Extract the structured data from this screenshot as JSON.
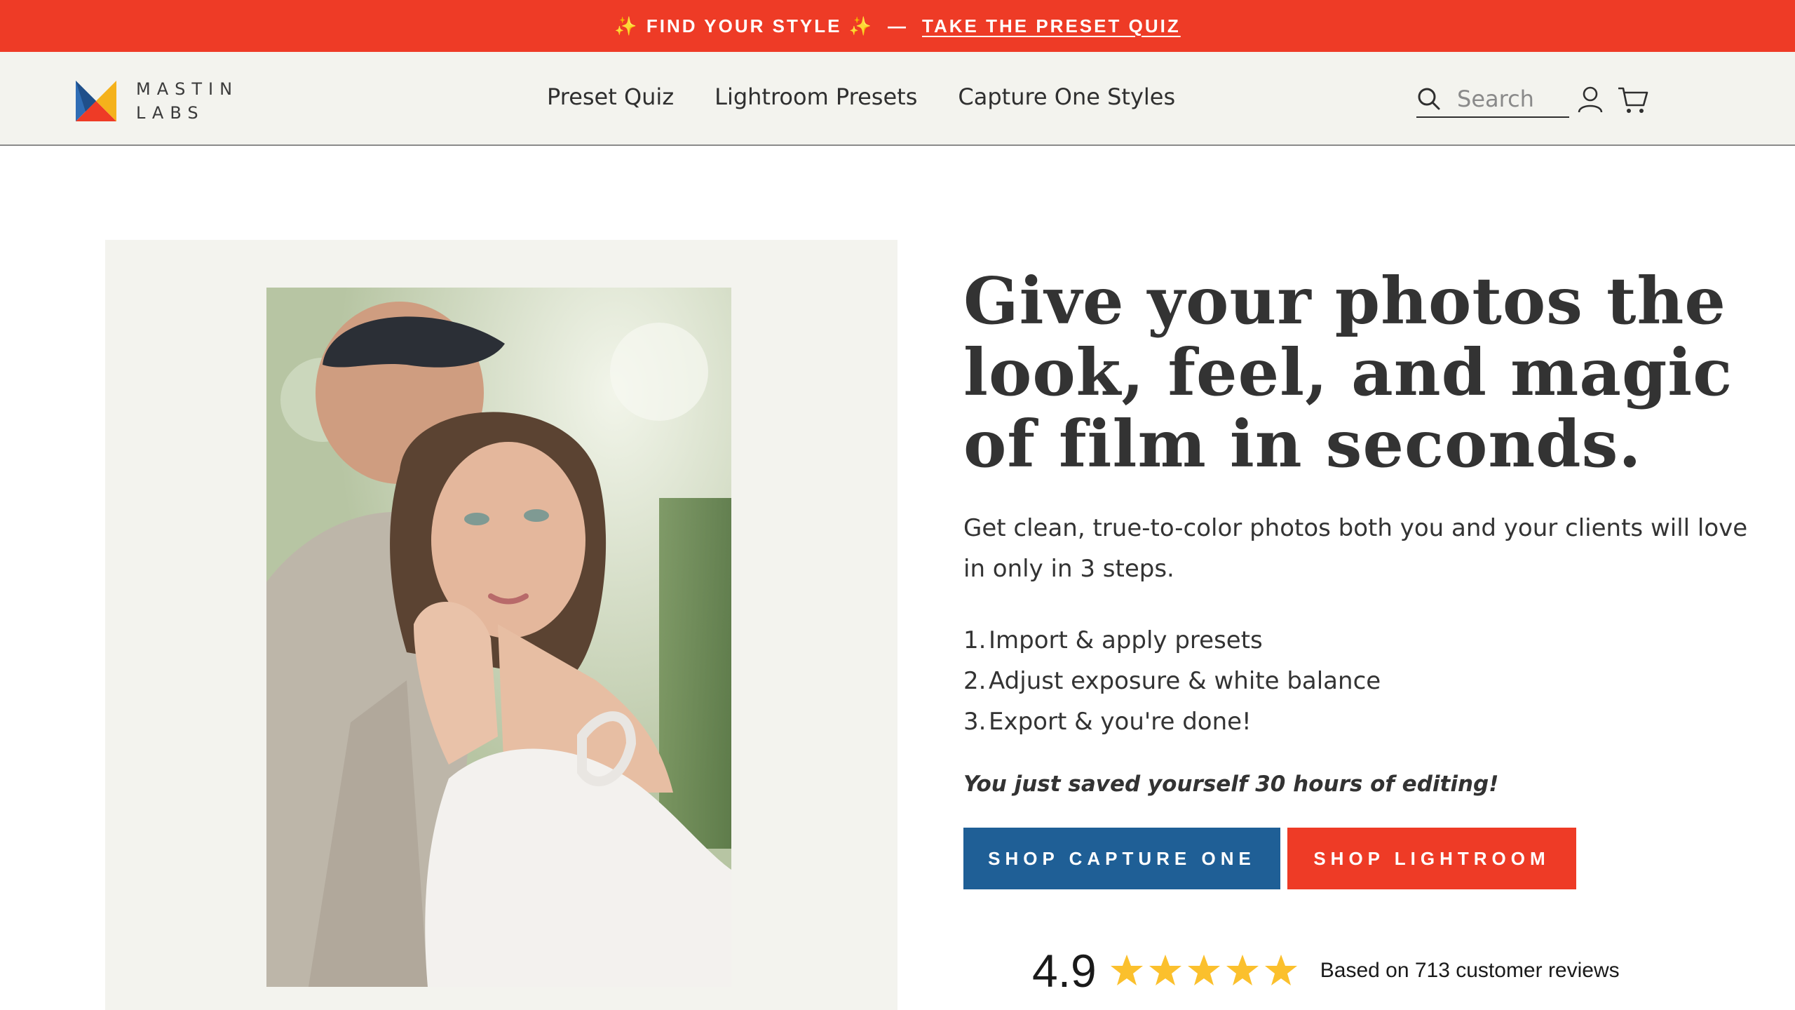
{
  "announcement": {
    "lead": "✨ FIND YOUR STYLE ✨",
    "separator": "—",
    "link": "TAKE THE PRESET QUIZ",
    "background": "#ee3b26"
  },
  "header": {
    "logo": {
      "line1": "MASTIN",
      "line2": "LABS",
      "icon": "mastin-labs-logo-icon"
    },
    "nav": [
      {
        "label": "Preset Quiz"
      },
      {
        "label": "Lightroom Presets"
      },
      {
        "label": "Capture One Styles"
      }
    ],
    "search": {
      "placeholder": "Search",
      "icon": "search-icon"
    },
    "icons": {
      "account": "user-icon",
      "cart": "cart-icon"
    }
  },
  "hero": {
    "image_alt": "Bride embracing groom outdoors",
    "title": "Give your photos the look, feel, and magic of film in seconds.",
    "subtitle": "Get clean, true-to-color photos both you and your clients will love in only in 3 steps.",
    "steps": [
      {
        "num": "1.",
        "text": "Import & apply presets"
      },
      {
        "num": "2.",
        "text": "Adjust exposure & white balance"
      },
      {
        "num": "3.",
        "text": "Export & you're done!"
      }
    ],
    "saved": "You just saved yourself 30 hours of editing!",
    "buttons": {
      "capture_one": "SHOP CAPTURE ONE",
      "lightroom": "SHOP LIGHTROOM"
    },
    "rating": {
      "score": "4.9",
      "stars": 5,
      "reviews": "Based on 713 customer reviews",
      "star_color": "#fbc02d"
    }
  },
  "colors": {
    "accent_red": "#ee3b26",
    "accent_blue": "#1f5f96",
    "header_bg": "#f3f3ee"
  }
}
